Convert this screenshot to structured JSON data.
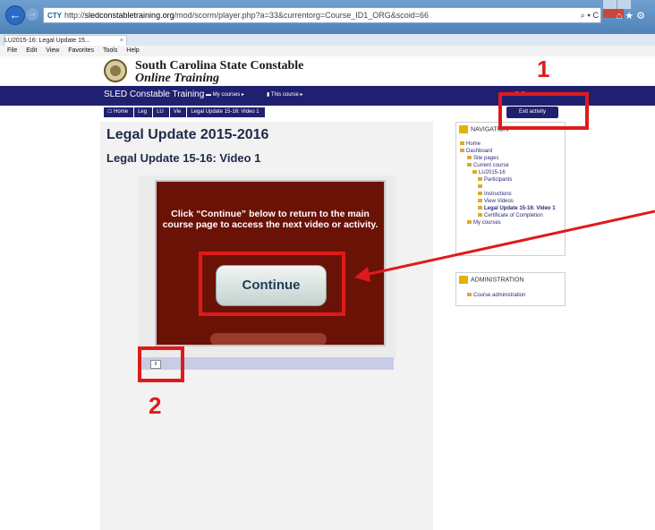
{
  "browser": {
    "url_domain": "sledconstabletraining.org",
    "url_path": "/mod/scorm/player.php?a=33&currentorg=Course_ID1_ORG&scoid=66",
    "url_scheme": "http://",
    "search_glyphs": "⌕ ▾ C",
    "tab_title": "LU2015-16: Legal Update 15...",
    "menu": [
      "File",
      "Edit",
      "View",
      "Favorites",
      "Tools",
      "Help"
    ]
  },
  "site": {
    "title": "South Carolina State Constable",
    "subtitle": "Online Training"
  },
  "navbar": {
    "brand": "SLED Constable Training",
    "my_courses": "My courses",
    "this_course": "This course"
  },
  "breadcrumb": [
    "Home",
    "Leg",
    "LU",
    "Vie",
    "Legal Update 15-16: Video 1"
  ],
  "exit_label": "Exit activity",
  "page": {
    "title": "Legal Update 2015-2016",
    "subtitle": "Legal Update 15-16: Video 1"
  },
  "slide": {
    "message": "Click “Continue” below to return to the main course page to access the next video or activity.",
    "continue_label": "Continue",
    "pause_label": "II"
  },
  "nav_block": {
    "header": "NAVIGATION",
    "items": [
      "Home",
      "Dashboard",
      "Site pages",
      "Current course",
      "LU2015-16",
      "Participants",
      "",
      "Instructions",
      "View Videos",
      "Legal Update 15-16: Video 1",
      "Certificate of Completion",
      "My courses"
    ]
  },
  "admin_block": {
    "header": "ADMINISTRATION",
    "item": "Course administration"
  },
  "annotations": {
    "callout_1": "1",
    "callout_2": "2",
    "color": "#e01a1a"
  }
}
